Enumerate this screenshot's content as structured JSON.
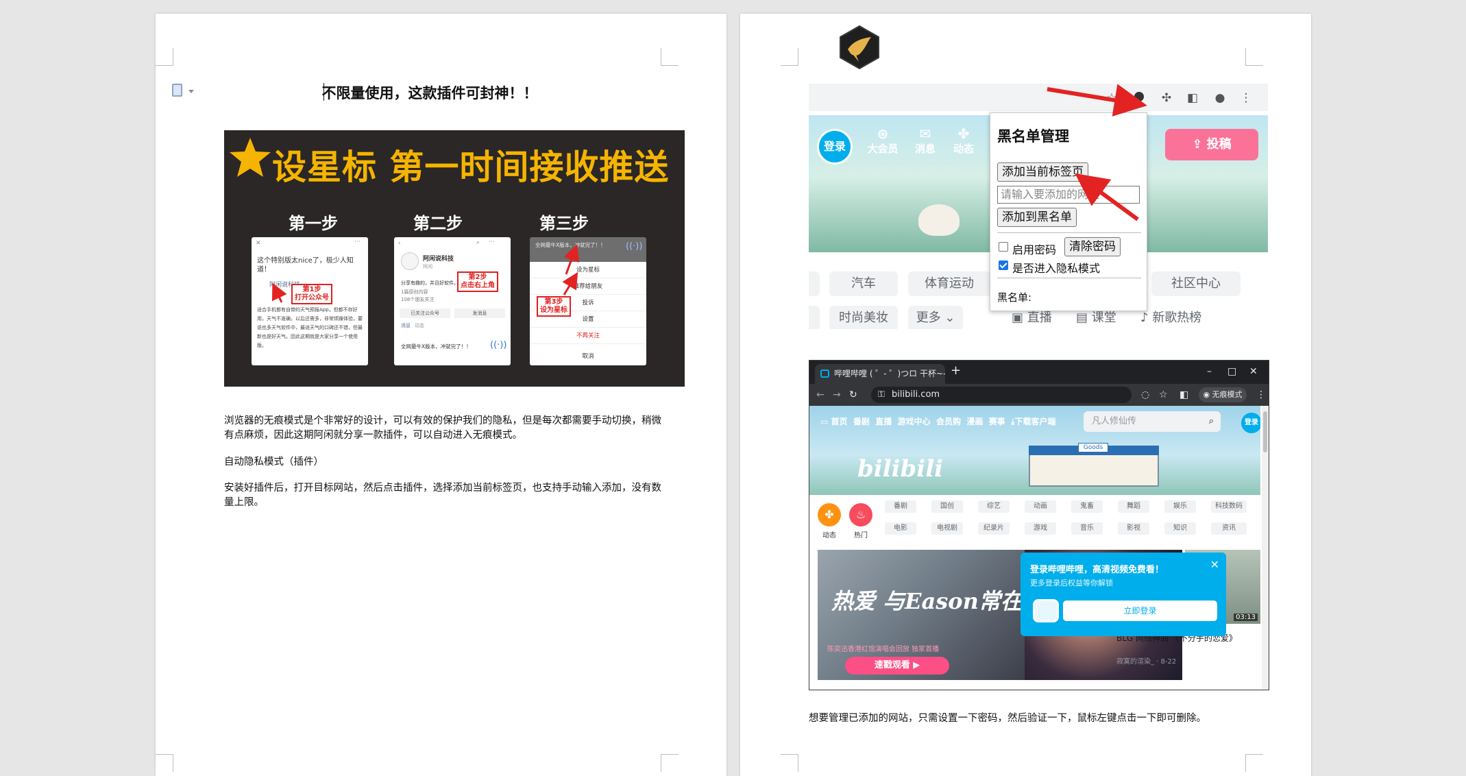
{
  "left_page": {
    "title": "不限量使用，这款插件可封神！！",
    "banner": {
      "headline": "设星标 第一时间接收推送",
      "steps": [
        "第一步",
        "第二步",
        "第三步"
      ],
      "step1": {
        "post_text": "这个特别版太nice了，极少人知道！",
        "author": "阿闲说科技",
        "body": "适合手机都有自带的天气预报App，但都不存好用，天气不准确，以后还需多，非常烦躁体验，要说也多天气软件中，最适天气的口碑还不错，但最新也是好天气。因此这期就是大家分享一个使用版。",
        "annotation_line1": "第1步",
        "annotation_line2": "打开公众号"
      },
      "step2": {
        "account": "阿闲说科技",
        "account_sub": "阿闲",
        "desc": "分享有趣的，并且好软件。",
        "stat1": "1篇原创内容",
        "stat2": "108个朋友关注",
        "btn1": "已关注公众号",
        "btn2": "发消息",
        "tab1": "消息",
        "tab2": "动态",
        "article": "全网最牛X版本，冲就完了！！",
        "annotation_line1": "第2步",
        "annotation_line2": "点击右上角"
      },
      "step3": {
        "header": "全网最牛X版本，冲就完了！！",
        "menu": [
          "设为星标",
          "推荐给朋友",
          "投诉",
          "设置",
          "不再关注",
          "取消"
        ],
        "annotation_line1": "第3步",
        "annotation_line2": "设为星标"
      }
    },
    "paragraphs": [
      "浏览器的无痕模式是个非常好的设计，可以有效的保护我们的隐私，但是每次都需要手动切换，稍微有点麻烦，因此这期阿闲就分享一款插件，可以自动进入无痕模式。",
      "自动隐私模式（插件）",
      "安装好插件后，打开目标网站，然后点击插件，选择添加当前标签页，也支持手动输入添加，没有数量上限。"
    ]
  },
  "right_page": {
    "bili_nav": {
      "login": "登录",
      "items": [
        "大会员",
        "消息",
        "动态"
      ],
      "upload": "投稿"
    },
    "categories_row1": [
      "汽车",
      "体育运动",
      "社区中心"
    ],
    "categories_row2": [
      "时尚美妆",
      "更多",
      "直播",
      "课堂",
      "新歌热榜"
    ],
    "popup": {
      "title": "黑名单管理",
      "add_current": "添加当前标签页",
      "input_placeholder": "请输入要添加的网址",
      "add_blacklist": "添加到黑名单",
      "enable_password": "启用密码",
      "clear_password": "清除密码",
      "incognito": "是否进入隐私模式",
      "blacklist_label": "黑名单:"
    },
    "browser": {
      "tab_title": "哔哩哔哩 ( ゜- ゜)つロ 干杯~-bilibili",
      "url": "bilibili.com",
      "incognito_badge": "无痕模式",
      "nav": [
        "首页",
        "番剧",
        "直播",
        "游戏中心",
        "会员购",
        "漫画",
        "赛事",
        "下载客户端"
      ],
      "search_placeholder": "凡人修仙传",
      "login": "登录",
      "logo": "bilibili",
      "store_sign": "Goods",
      "feed_icons": [
        "动态",
        "热门"
      ],
      "chips_row1": [
        "番剧",
        "国创",
        "综艺",
        "动画",
        "鬼畜",
        "舞蹈",
        "娱乐",
        "科技数码"
      ],
      "chips_row2": [
        "电影",
        "电视剧",
        "纪录片",
        "游戏",
        "音乐",
        "影视",
        "知识",
        "资讯"
      ],
      "promo_title": "热爱 与Eason常在",
      "promo_sub": "陈奕迅香港红馆演唱会回放 独家首播",
      "promo_button": "速戳观看 ▶",
      "login_popup": {
        "title": "登录哔哩哔哩，高清视频免费看！",
        "sub": "更多登录后权益等你解锁",
        "button": "立即登录"
      },
      "side_duration": "03:13",
      "side_title": "BLG 网络神曲 《不分手的恋爱》",
      "side_meta": "寂寞的渲染_ · 8-22"
    },
    "caption": "想要管理已添加的网站，只需设置一下密码，然后验证一下，鼠标左键点击一下即可删除。"
  }
}
